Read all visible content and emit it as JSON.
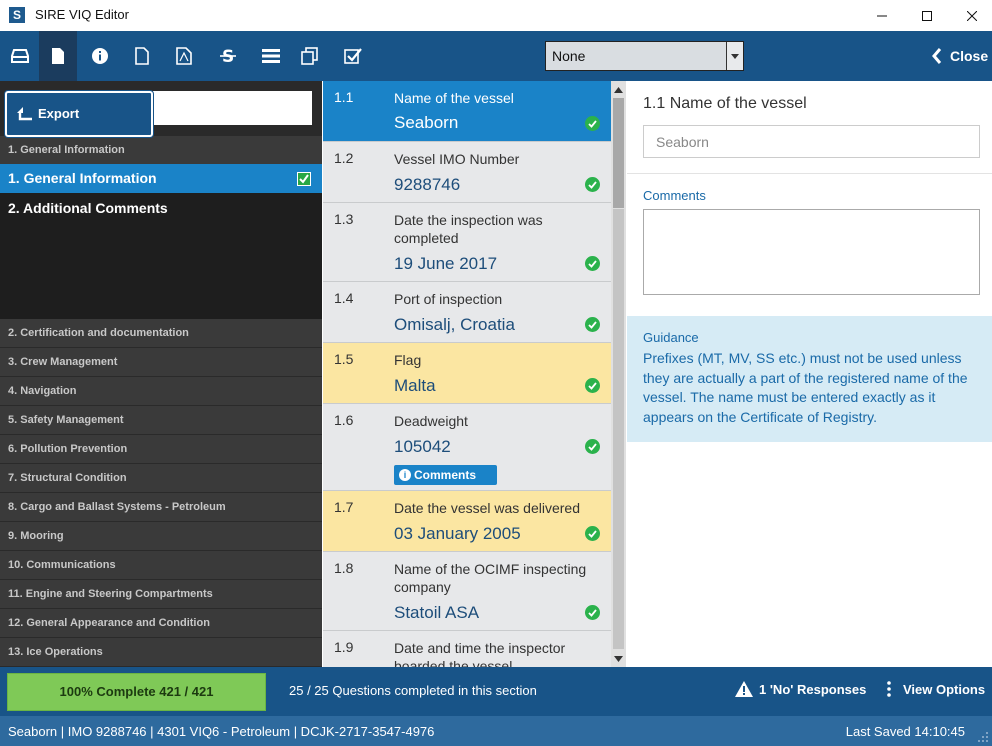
{
  "window": {
    "title": "SIRE VIQ Editor",
    "logo_letter": "S"
  },
  "toolbar": {
    "section_select": {
      "value": "None"
    },
    "close_label": "Close"
  },
  "export_popup": {
    "label": "Export"
  },
  "left_panel": {
    "header_1": "1. General Information",
    "sub_items": [
      {
        "label": "1.  General Information",
        "checked": true
      },
      {
        "label": "2.  Additional Comments",
        "checked": false
      }
    ],
    "categories": [
      "2. Certification and documentation",
      "3. Crew Management",
      "4. Navigation",
      "5. Safety Management",
      "6. Pollution Prevention",
      "7. Structural Condition",
      "8. Cargo and Ballast Systems - Petroleum",
      "9. Mooring",
      "10. Communications",
      "11. Engine and Steering Compartments",
      "12. General Appearance and Condition",
      "13. Ice Operations"
    ]
  },
  "questions": [
    {
      "num": "1.1",
      "text": "Name of the vessel",
      "answer": "Seaborn",
      "state": "selected"
    },
    {
      "num": "1.2",
      "text": "Vessel IMO Number",
      "answer": "9288746",
      "state": "normal"
    },
    {
      "num": "1.3",
      "text": "Date the inspection was completed",
      "answer": "19 June 2017",
      "state": "normal"
    },
    {
      "num": "1.4",
      "text": "Port of inspection",
      "answer": "Omisalj, Croatia",
      "state": "normal"
    },
    {
      "num": "1.5",
      "text": "Flag",
      "answer": "Malta",
      "state": "highlight"
    },
    {
      "num": "1.6",
      "text": "Deadweight",
      "answer": "105042",
      "state": "normal",
      "badge": "Comments"
    },
    {
      "num": "1.7",
      "text": "Date the vessel was delivered",
      "answer": "03 January 2005",
      "state": "highlight"
    },
    {
      "num": "1.8",
      "text": "Name of the OCIMF inspecting company",
      "answer": "Statoil ASA",
      "state": "normal"
    },
    {
      "num": "1.9",
      "text": "Date and time the inspector boarded the vessel",
      "answer": "",
      "state": "normal"
    }
  ],
  "detail": {
    "title": "1.1 Name of the vessel",
    "input_value": "Seaborn",
    "comments_label": "Comments",
    "guidance_label": "Guidance",
    "guidance_text": "Prefixes (MT, MV, SS etc.) must not be used unless they are actually a part of the registered name of the vessel.  The name must be entered exactly as it appears on the Certificate of Registry."
  },
  "status": {
    "progress_label": "100% Complete 421 / 421",
    "progress_fraction": 1.0,
    "section_complete": "25 / 25 Questions completed in this section",
    "no_responses": "1 'No' Responses",
    "view_options": "View Options"
  },
  "footer": {
    "info": "Seaborn  |  IMO 9288746  |  4301 VIQ6 - Petroleum  |  DCJK-2717-3547-4976",
    "last_saved": "Last Saved 14:10:45"
  },
  "colors": {
    "primary": "#185488",
    "selected": "#1a83c8",
    "highlight": "#fbe6a2",
    "success": "#2bb24c",
    "progress": "#7fc957"
  }
}
